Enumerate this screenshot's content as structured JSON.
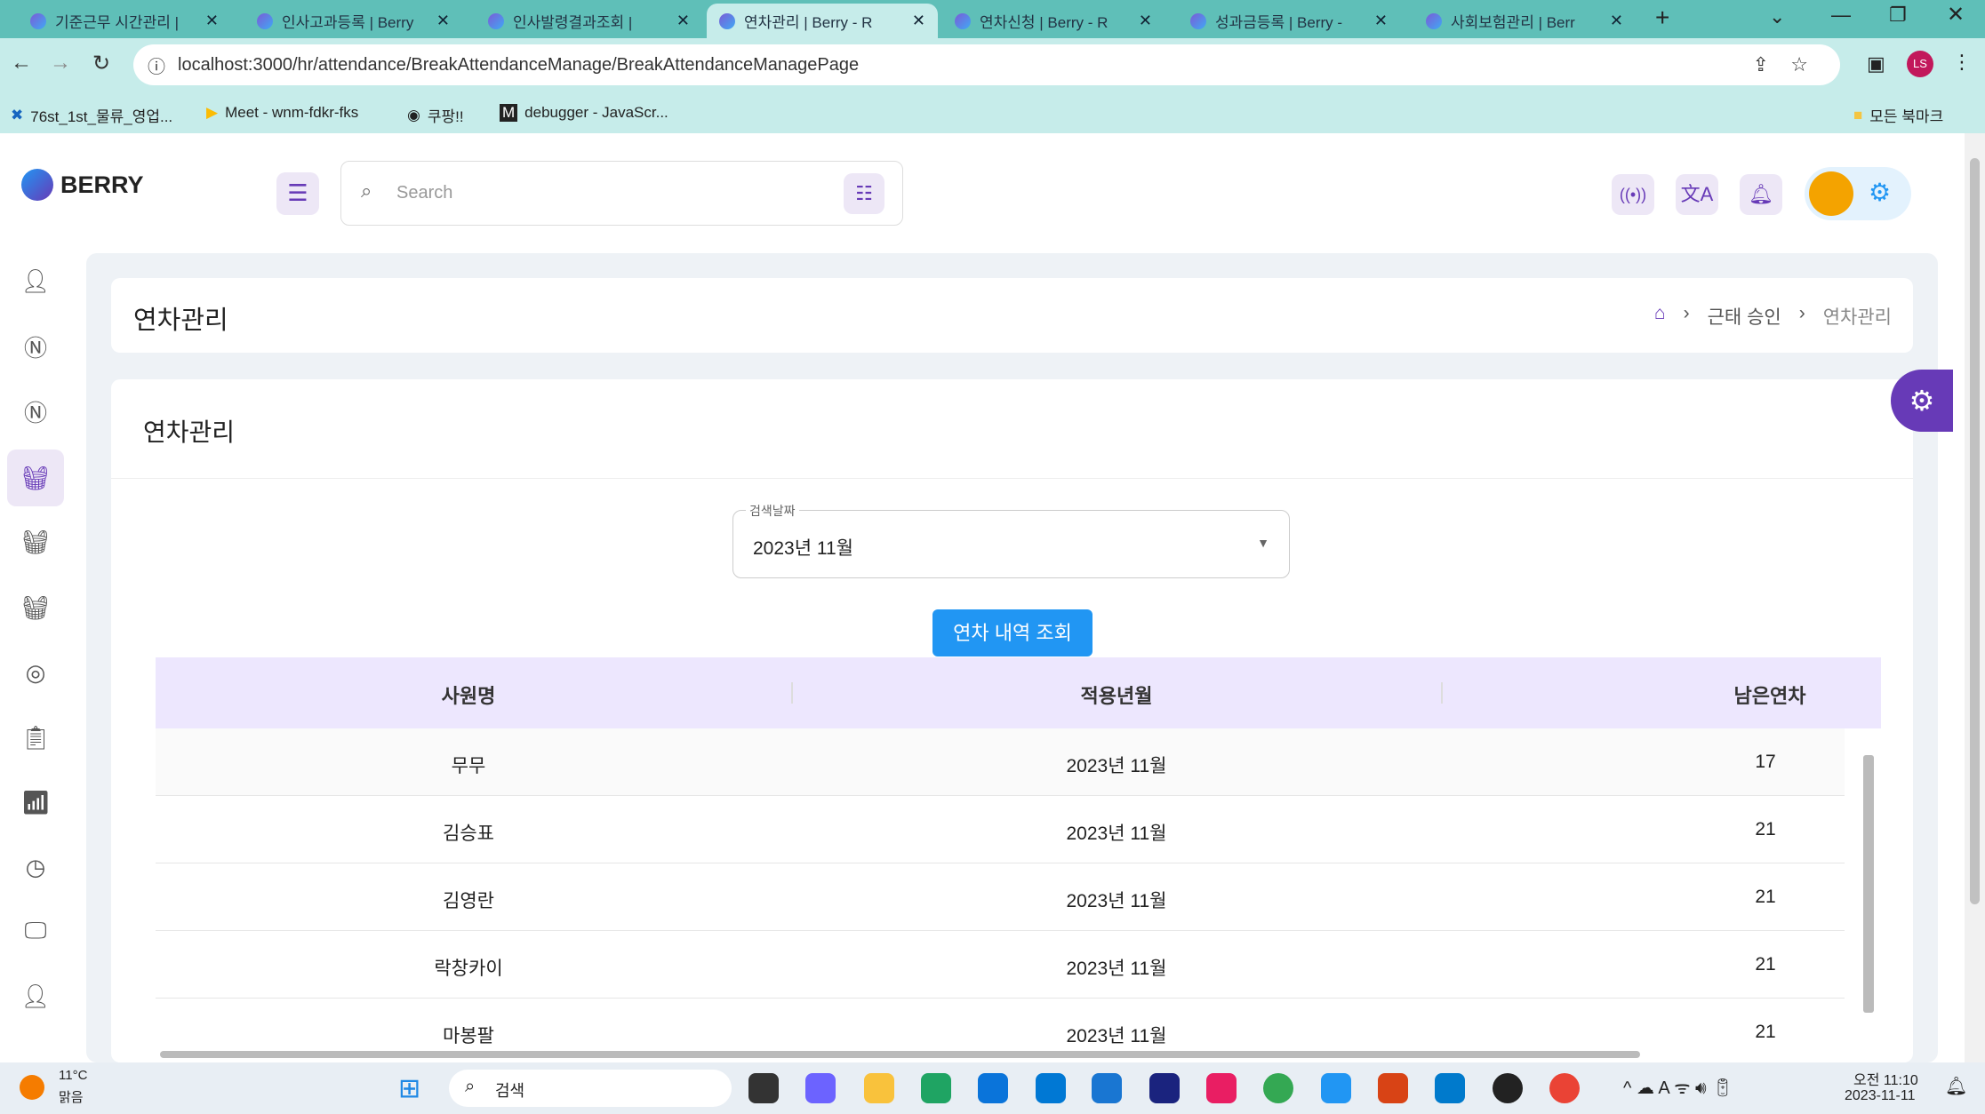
{
  "browser": {
    "tabs": [
      {
        "title": "기준근무 시간관리 |"
      },
      {
        "title": "인사고과등록 | Berry"
      },
      {
        "title": "인사발령결과조회 |"
      },
      {
        "title": "연차관리 | Berry - R"
      },
      {
        "title": "연차신청 | Berry - R"
      },
      {
        "title": "성과금등록 | Berry -"
      },
      {
        "title": "사회보험관리 | Berr"
      }
    ],
    "active_tab": 3,
    "url": "localhost:3000/hr/attendance/BreakAttendanceManage/BreakAttendanceManagePage",
    "bookmarks": [
      {
        "label": "76st_1st_물류_영업..."
      },
      {
        "label": "Meet - wnm-fdkr-fks"
      },
      {
        "label": "쿠팡!!"
      },
      {
        "label": "debugger - JavaScr..."
      }
    ],
    "all_bookmarks": "모든 북마크"
  },
  "app": {
    "logo": "BERRY",
    "search_placeholder": "Search",
    "page_title": "연차관리",
    "breadcrumb": [
      "근태 승인",
      "연차관리"
    ],
    "card_title": "연차관리",
    "select": {
      "label": "검색날짜",
      "value": "2023년 11월"
    },
    "search_button": "연차 내역 조회",
    "table": {
      "headers": [
        "사원명",
        "적용년월",
        "남은연차"
      ],
      "rows": [
        [
          "무무",
          "2023년 11월",
          "17"
        ],
        [
          "김승표",
          "2023년 11월",
          "21"
        ],
        [
          "김영란",
          "2023년 11월",
          "21"
        ],
        [
          "락창카이",
          "2023년 11월",
          "21"
        ],
        [
          "마봉팔",
          "2023년 11월",
          "21"
        ]
      ]
    }
  },
  "taskbar": {
    "weather_temp": "11°C",
    "weather_desc": "맑음",
    "search": "검색",
    "time": "오전 11:10",
    "date": "2023-11-11"
  },
  "colors": {
    "primary": "#673ab7",
    "button": "#2196f3",
    "table_header": "#ede7fe",
    "tabbar": "#5fbfb8"
  }
}
